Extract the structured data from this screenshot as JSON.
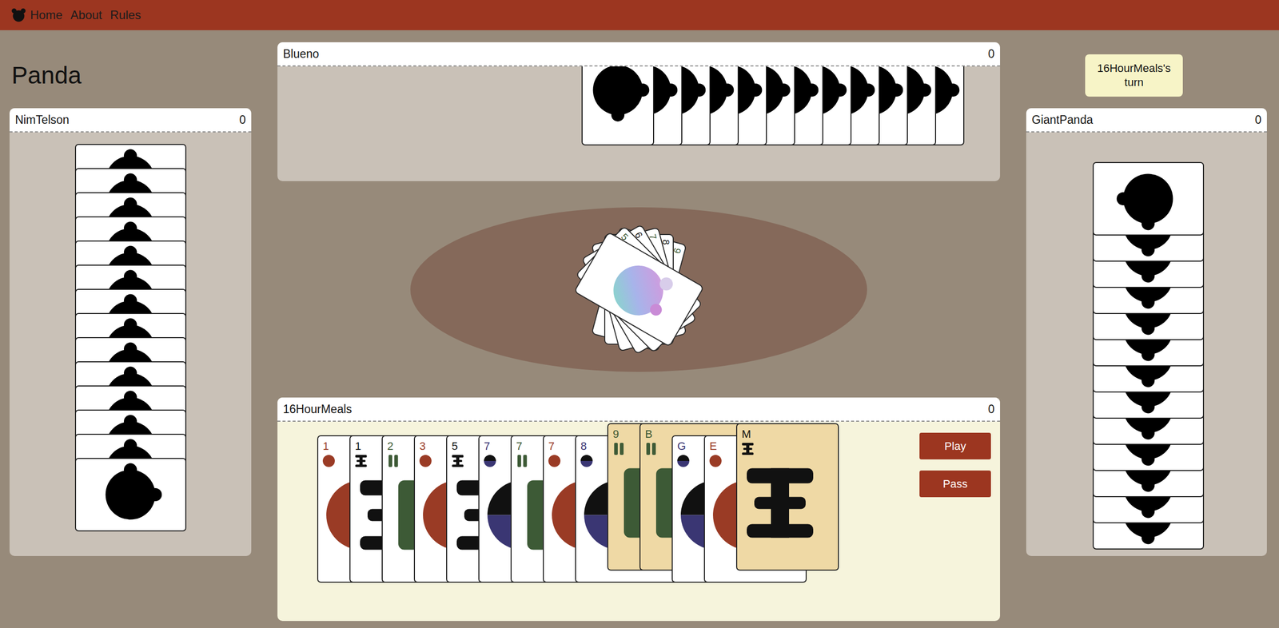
{
  "navbar": {
    "links": [
      {
        "label": "Home"
      },
      {
        "label": "About"
      },
      {
        "label": "Rules"
      }
    ]
  },
  "game": {
    "title": "Panda"
  },
  "turn": {
    "label": "16HourMeals's turn"
  },
  "left_player": {
    "name": "NimTelson",
    "score": "0",
    "hand_size": 14
  },
  "top_player": {
    "name": "Blueno",
    "score": "0",
    "hand_size": 12
  },
  "right_player": {
    "name": "GiantPanda",
    "score": "0",
    "hand_size": 13
  },
  "pile": {
    "cards": [
      {
        "value": "5",
        "color": "#3d5a36"
      },
      {
        "value": "6",
        "color": "#111111"
      },
      {
        "value": "7",
        "color": "#3d5a36"
      },
      {
        "value": "8",
        "color": "#111111"
      },
      {
        "value": "9",
        "color": "#3d5a36"
      }
    ],
    "top_card": {
      "kind": "wild"
    }
  },
  "player": {
    "name": "16HourMeals",
    "score": "0",
    "hand": [
      {
        "value": "1",
        "kind": "circle",
        "color": "#9a3b25",
        "selected": false
      },
      {
        "value": "1",
        "kind": "beam",
        "color": "#111111",
        "selected": false
      },
      {
        "value": "2",
        "kind": "bars",
        "color": "#3d5a36",
        "selected": false
      },
      {
        "value": "3",
        "kind": "circle",
        "color": "#9a3b25",
        "selected": false
      },
      {
        "value": "5",
        "kind": "beam",
        "color": "#111111",
        "selected": false
      },
      {
        "value": "7",
        "kind": "moon",
        "color": "#3a3673",
        "selected": false
      },
      {
        "value": "7",
        "kind": "bars",
        "color": "#3d5a36",
        "selected": false
      },
      {
        "value": "7",
        "kind": "circle",
        "color": "#9a3b25",
        "selected": false
      },
      {
        "value": "8",
        "kind": "moon",
        "color": "#3a3673",
        "selected": false
      },
      {
        "value": "9",
        "kind": "bars",
        "color": "#3d5a36",
        "selected": true
      },
      {
        "value": "B",
        "kind": "bars",
        "color": "#3d5a36",
        "selected": true
      },
      {
        "value": "G",
        "kind": "moon",
        "color": "#3a3673",
        "selected": false
      },
      {
        "value": "E",
        "kind": "circle",
        "color": "#9a3b25",
        "selected": false
      },
      {
        "value": "M",
        "kind": "beam",
        "color": "#111111",
        "selected": true
      }
    ]
  },
  "buttons": [
    {
      "label": "Play"
    },
    {
      "label": "Pass"
    }
  ]
}
